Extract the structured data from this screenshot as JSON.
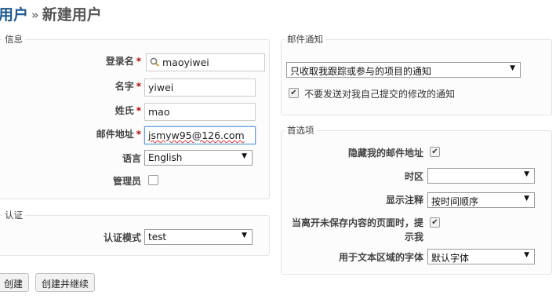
{
  "header": {
    "crumb": "用户",
    "separator": "»",
    "title": "新建用户"
  },
  "info": {
    "legend": "信息",
    "login_label": "登录名",
    "login_value": "maoyiwei",
    "firstname_label": "名字",
    "firstname_value": "yiwei",
    "lastname_label": "姓氏",
    "lastname_value": "mao",
    "email_label": "邮件地址",
    "email_value": "jsmyw95@126.com",
    "language_label": "语言",
    "language_value": "English",
    "admin_label": "管理员",
    "required_mark": "*"
  },
  "auth": {
    "legend": "认证",
    "mode_label": "认证模式",
    "mode_value": "test"
  },
  "mail": {
    "legend": "邮件通知",
    "select_value": "只收取我跟踪或参与的项目的通知",
    "no_self_label": "不要发送对我自己提交的修改的通知",
    "no_self_checked": true
  },
  "prefs": {
    "legend": "首选项",
    "hide_mail_label": "隐藏我的邮件地址",
    "hide_mail_checked": true,
    "timezone_label": "时区",
    "timezone_value": "",
    "comments_label": "显示注释",
    "comments_value": "按时间顺序",
    "warn_label_1": "当离开未保存内容的页面时，提",
    "warn_label_2": "示我",
    "warn_checked": true,
    "font_label": "用于文本区域的字体",
    "font_value": "默认字体"
  },
  "buttons": {
    "create": "创建",
    "create_continue": "创建并继续"
  },
  "icons": {
    "dropdown": "▼",
    "check": "✔"
  }
}
